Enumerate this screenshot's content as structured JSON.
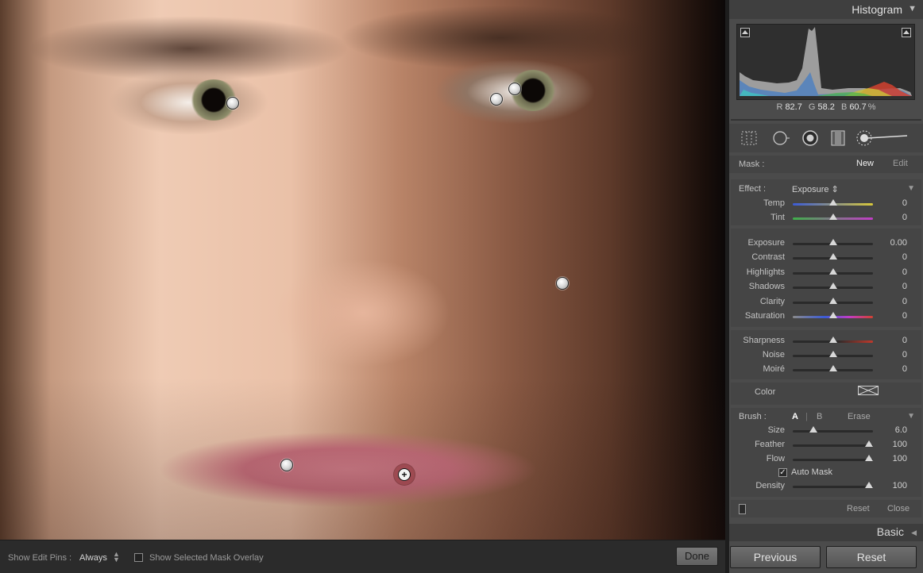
{
  "toolbar": {
    "show_edit_pins_label": "Show Edit Pins :",
    "show_edit_pins_value": "Always",
    "show_mask_overlay_label": "Show Selected Mask Overlay",
    "show_mask_overlay_checked": false,
    "done_label": "Done"
  },
  "histogram": {
    "title": "Histogram",
    "r_label": "R",
    "r_value": "82.7",
    "g_label": "G",
    "g_value": "58.2",
    "b_label": "B",
    "b_value": "60.7",
    "percent": "%"
  },
  "tools": [
    "crop-overlay-icon",
    "spot-removal-icon",
    "red-eye-icon",
    "graduated-filter-icon",
    "adjustment-brush-icon"
  ],
  "mask": {
    "label": "Mask :",
    "new": "New",
    "edit": "Edit"
  },
  "effect": {
    "label": "Effect :",
    "preset": "Exposure",
    "sliders_a": [
      {
        "label": "Temp",
        "value": "0",
        "pos": 0.5
      },
      {
        "label": "Tint",
        "value": "0",
        "pos": 0.5
      }
    ],
    "sliders_b": [
      {
        "label": "Exposure",
        "value": "0.00",
        "pos": 0.5
      },
      {
        "label": "Contrast",
        "value": "0",
        "pos": 0.5
      },
      {
        "label": "Highlights",
        "value": "0",
        "pos": 0.5
      },
      {
        "label": "Shadows",
        "value": "0",
        "pos": 0.5
      },
      {
        "label": "Clarity",
        "value": "0",
        "pos": 0.5
      },
      {
        "label": "Saturation",
        "value": "0",
        "pos": 0.5
      }
    ],
    "sliders_c": [
      {
        "label": "Sharpness",
        "value": "0",
        "pos": 0.5
      },
      {
        "label": "Noise",
        "value": "0",
        "pos": 0.5
      },
      {
        "label": "Moiré",
        "value": "0",
        "pos": 0.5
      }
    ],
    "color_label": "Color"
  },
  "brush": {
    "label": "Brush :",
    "a": "A",
    "b": "B",
    "erase": "Erase",
    "sliders": [
      {
        "label": "Size",
        "value": "6.0",
        "pos": 0.26
      },
      {
        "label": "Feather",
        "value": "100",
        "pos": 0.95
      },
      {
        "label": "Flow",
        "value": "100",
        "pos": 0.95
      }
    ],
    "auto_mask_label": "Auto Mask",
    "auto_mask_checked": true,
    "density": {
      "label": "Density",
      "value": "100",
      "pos": 0.95
    }
  },
  "footer": {
    "reset": "Reset",
    "close": "Close"
  },
  "basic": {
    "title": "Basic"
  },
  "buttons": {
    "previous": "Previous",
    "reset": "Reset"
  },
  "colors": {
    "panel_bg": "#4b4b4b",
    "temp_gradient": [
      "#3b5bd6",
      "#d8c83a"
    ],
    "tint_gradient": [
      "#3fb04a",
      "#c23cc7"
    ],
    "sharpness_accent": "#c0392b"
  }
}
